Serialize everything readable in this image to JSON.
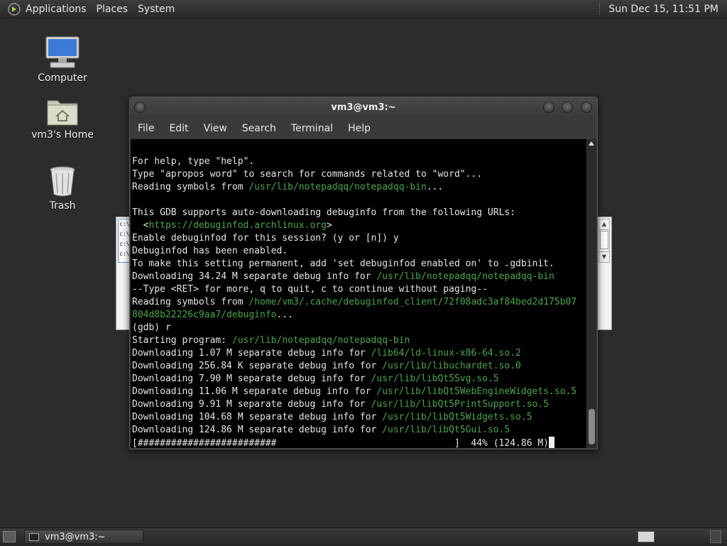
{
  "top_panel": {
    "menus": [
      "Applications",
      "Places",
      "System"
    ],
    "clock": "Sun Dec 15, 11:51 PM"
  },
  "desktop_icons": [
    {
      "label": "Computer",
      "icon": "computer-icon"
    },
    {
      "label": "vm3's Home",
      "icon": "home-folder-icon"
    },
    {
      "label": "Trash",
      "icon": "trash-icon"
    }
  ],
  "background_window": {
    "list_fragment": [
      "c:\\",
      "c:\\",
      "c:\\",
      "c:\\"
    ]
  },
  "terminal": {
    "title": "vm3@vm3:~",
    "menu": [
      "File",
      "Edit",
      "View",
      "Search",
      "Terminal",
      "Help"
    ],
    "lines": [
      {
        "text": "For help, type \"help\"."
      },
      {
        "text": "Type \"apropos word\" to search for commands related to \"word\"..."
      },
      {
        "text": "Reading symbols from ",
        "path": "/usr/lib/notepadqq/notepadqq-bin",
        "after": "..."
      },
      {
        "text": ""
      },
      {
        "text": "This GDB supports auto-downloading debuginfo from the following URLs:"
      },
      {
        "text": "  <",
        "path": "https://debuginfod.archlinux.org",
        "after": ">"
      },
      {
        "text": "Enable debuginfod for this session? (y or [n]) y"
      },
      {
        "text": "Debuginfod has been enabled."
      },
      {
        "text": "To make this setting permanent, add 'set debuginfod enabled on' to .gdbinit."
      },
      {
        "text": "Downloading 34.24 M separate debug info for ",
        "path": "/usr/lib/notepadqq/notepadqq-bin"
      },
      {
        "text": "--Type <RET> for more, q to quit, c to continue without paging--"
      },
      {
        "text": "Reading symbols from ",
        "path": "/home/vm3/.cache/debuginfod_client/72f08adc3af84bed2d175b07"
      },
      {
        "text": "",
        "path": "804d8b22226c9aa7/debuginfo",
        "after": "..."
      },
      {
        "text": "(gdb) r"
      },
      {
        "text": "Starting program: ",
        "path": "/usr/lib/notepadqq/notepadqq-bin"
      },
      {
        "text": "Downloading 1.07 M separate debug info for ",
        "path": "/lib64/ld-linux-x86-64.so.2"
      },
      {
        "text": "Downloading 256.84 K separate debug info for ",
        "path": "/usr/lib/libuchardet.so.0"
      },
      {
        "text": "Downloading 7.90 M separate debug info for ",
        "path": "/usr/lib/libQt5Svg.so.5"
      },
      {
        "text": "Downloading 11.06 M separate debug info for ",
        "path": "/usr/lib/libQt5WebEngineWidgets.so.5"
      },
      {
        "text": "Downloading 9.91 M separate debug info for ",
        "path": "/usr/lib/libQt5PrintSupport.so.5"
      },
      {
        "text": "Downloading 104.68 M separate debug info for ",
        "path": "/usr/lib/libQt5Widgets.so.5"
      },
      {
        "text": "Downloading 124.86 M separate debug info for ",
        "path": "/usr/lib/libQt5Gui.so.5"
      },
      {
        "text": "[#########################                                ]  44% (124.86 M)",
        "cursor": true
      }
    ],
    "path_color": "#4aa64a"
  },
  "bottom_panel": {
    "task_label": "vm3@vm3:~"
  }
}
